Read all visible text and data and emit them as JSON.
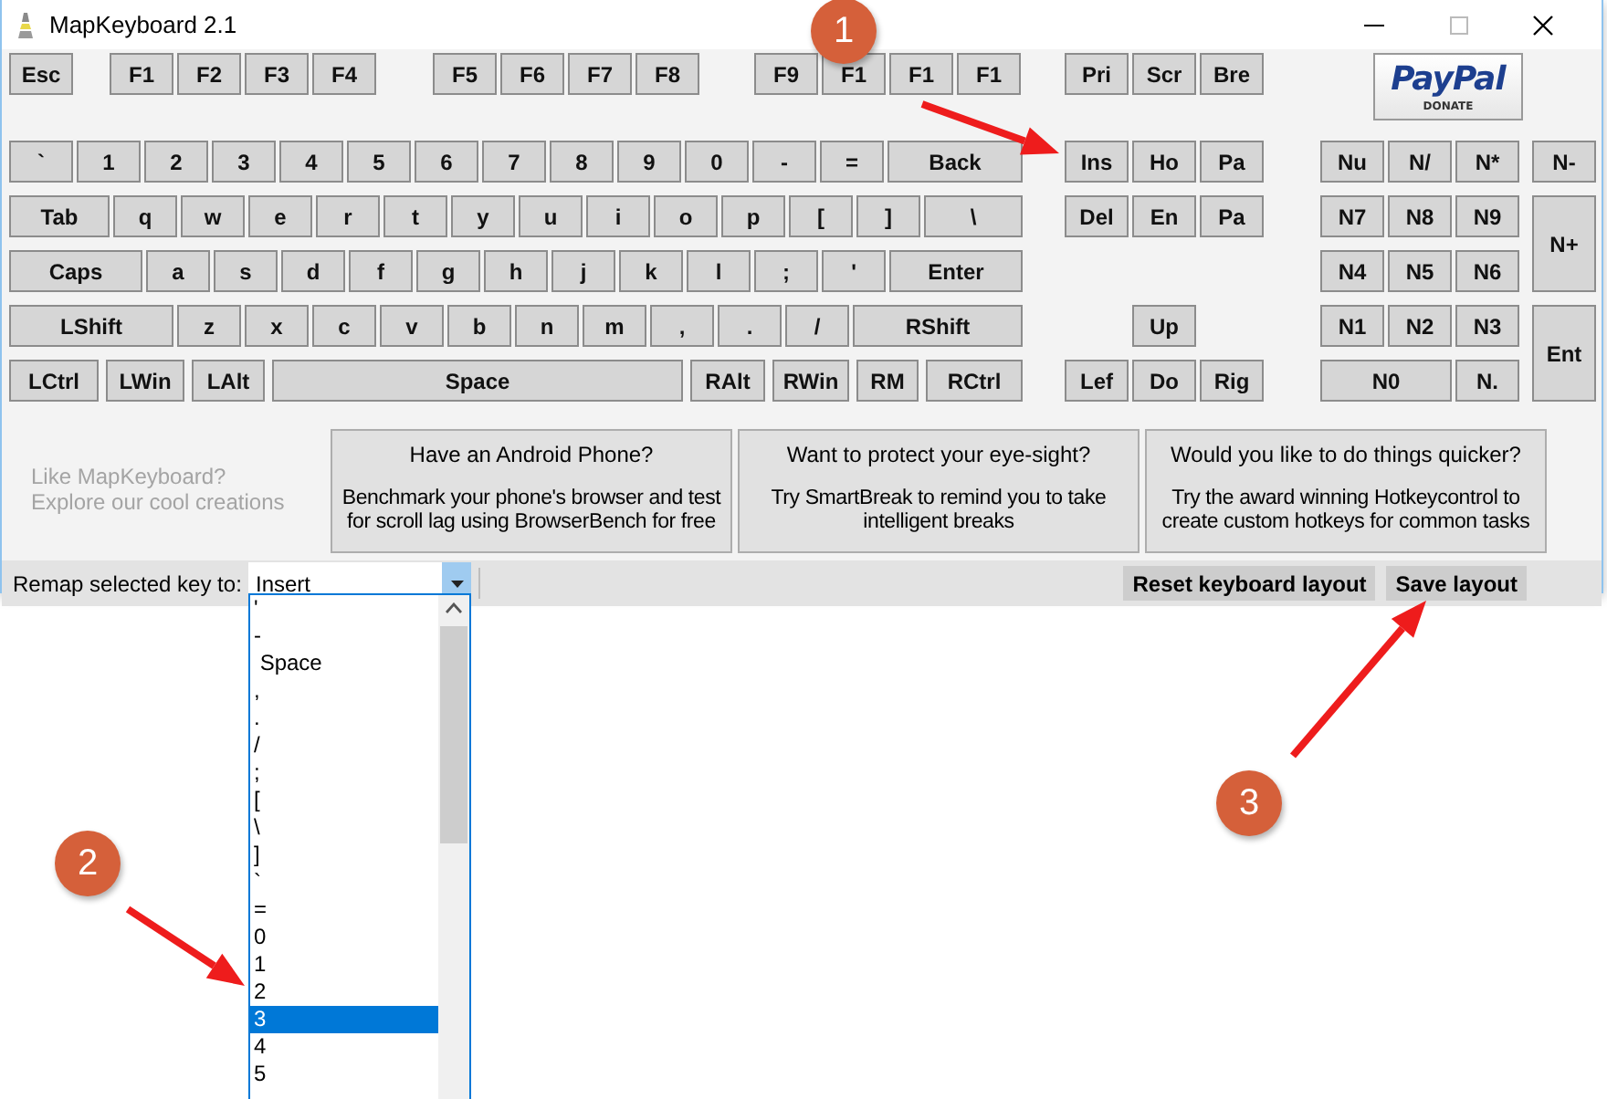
{
  "window": {
    "title": "MapKeyboard 2.1"
  },
  "function_row": [
    "Esc",
    "F1",
    "F2",
    "F3",
    "F4",
    "F5",
    "F6",
    "F7",
    "F8",
    "F9",
    "F1",
    "F1",
    "F1"
  ],
  "system_keys": [
    "Pri",
    "Scr",
    "Bre"
  ],
  "paypal_button": {
    "logo": "PayPal",
    "caption": "DONATE"
  },
  "main_rows": [
    [
      "`",
      "1",
      "2",
      "3",
      "4",
      "5",
      "6",
      "7",
      "8",
      "9",
      "0",
      "-",
      "=",
      "Back"
    ],
    [
      "Tab",
      "q",
      "w",
      "e",
      "r",
      "t",
      "y",
      "u",
      "i",
      "o",
      "p",
      "[",
      "]",
      "\\"
    ],
    [
      "Caps",
      "a",
      "s",
      "d",
      "f",
      "g",
      "h",
      "j",
      "k",
      "l",
      ";",
      "'",
      "Enter"
    ],
    [
      "LShift",
      "z",
      "x",
      "c",
      "v",
      "b",
      "n",
      "m",
      ",",
      ".",
      "/",
      "RShift"
    ],
    [
      "LCtrl",
      "LWin",
      "LAlt",
      "Space",
      "RAlt",
      "RWin",
      "RM",
      "RCtrl"
    ]
  ],
  "navigation_keys": [
    "Ins",
    "Ho",
    "Pa",
    "Del",
    "En",
    "Pa",
    "Up",
    "Lef",
    "Do",
    "Rig"
  ],
  "numpad_keys": [
    "Nu",
    "N/",
    "N*",
    "N-",
    "N7",
    "N8",
    "N9",
    "N+",
    "N4",
    "N5",
    "N6",
    "N1",
    "N2",
    "N3",
    "Ent",
    "N0",
    "N."
  ],
  "promo_text": [
    "Like MapKeyboard?",
    "Explore our cool creations"
  ],
  "promos": [
    {
      "title": "Have an Android Phone?",
      "body": "Benchmark your phone's browser and test for scroll lag using BrowserBench for free"
    },
    {
      "title": "Want to protect your eye-sight?",
      "body": "Try SmartBreak to remind you to take intelligent breaks"
    },
    {
      "title": "Would you like to do things quicker?",
      "body": "Try the award winning Hotkeycontrol to create custom hotkeys for common tasks"
    }
  ],
  "status_bar": {
    "label": "Remap selected key to:",
    "value": "Insert",
    "buttons": [
      "Reset keyboard layout",
      "Save layout"
    ]
  },
  "dropdown_items": [
    {
      "label": "'",
      "selected": false
    },
    {
      "label": "-",
      "selected": false
    },
    {
      "label": " Space",
      "selected": false
    },
    {
      "label": ",",
      "selected": false
    },
    {
      "label": ".",
      "selected": false
    },
    {
      "label": "/",
      "selected": false
    },
    {
      "label": ";",
      "selected": false
    },
    {
      "label": "[",
      "selected": false
    },
    {
      "label": "\\",
      "selected": false
    },
    {
      "label": "]",
      "selected": false
    },
    {
      "label": "`",
      "selected": false
    },
    {
      "label": "=",
      "selected": false
    },
    {
      "label": "0",
      "selected": false
    },
    {
      "label": "1",
      "selected": false
    },
    {
      "label": "2",
      "selected": false
    },
    {
      "label": "3",
      "selected": true
    },
    {
      "label": "4",
      "selected": false
    },
    {
      "label": "5",
      "selected": false
    }
  ],
  "annotations": [
    {
      "label": "1"
    },
    {
      "label": "2"
    },
    {
      "label": "3"
    }
  ]
}
